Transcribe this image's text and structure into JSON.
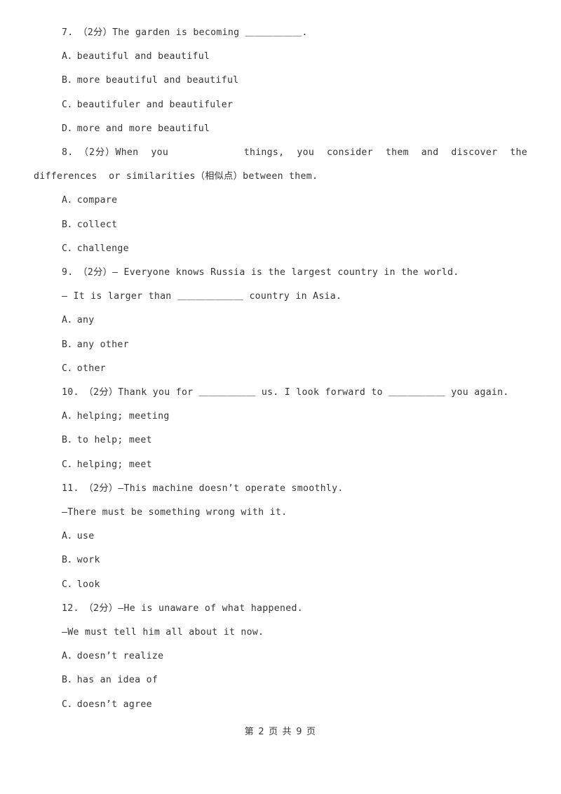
{
  "document": {
    "page_label": "第 2 页 共 9 页",
    "text_color": "#343434",
    "background_color": "#ffffff"
  },
  "questions": [
    {
      "number": "7.",
      "marks": "（2分）",
      "stem": "7.　（2分）The garden is becoming ＿＿＿＿＿＿.",
      "options": [
        "A．beautiful and beautiful",
        "B．more beautiful and beautiful",
        "C．beautifuler and beautifuler",
        "D．more and more beautiful"
      ]
    },
    {
      "number": "8.",
      "marks": "（2分）",
      "stem": "8.　（2分）When  you            things,  you  consider  them  and  discover  the  differences  or similarities（相似点）between them.",
      "options": [
        "A．compare",
        "B．collect",
        "C．challenge"
      ]
    },
    {
      "number": "9.",
      "marks": "（2分）",
      "stem": "9.　（2分）— Everyone knows Russia is the largest country in the world.",
      "stem_cont": "— It is larger than ＿＿＿＿＿＿＿ country in Asia.",
      "options": [
        "A．any",
        "B．any other",
        "C．other"
      ]
    },
    {
      "number": "10.",
      "marks": "（2分）",
      "stem": "10.　（2分）Thank you for ＿＿＿＿＿＿ us. I look forward to ＿＿＿＿＿＿ you again.",
      "options": [
        "A．helping; meeting",
        "B．to help; meet",
        "C．helping; meet"
      ]
    },
    {
      "number": "11.",
      "marks": "（2分）",
      "stem": "11.　（2分）—This machine doesn’t operate smoothly.",
      "stem_cont": "—There must be something wrong with it.",
      "options": [
        "A．use",
        "B．work",
        "C．look"
      ]
    },
    {
      "number": "12.",
      "marks": "（2分）",
      "stem": "12.　（2分）—He is unaware of what happened.",
      "stem_cont": "—We must tell him all about it now.",
      "options": [
        "A．doesn’t realize",
        "B．has an idea of",
        "C．doesn’t agree"
      ]
    }
  ]
}
